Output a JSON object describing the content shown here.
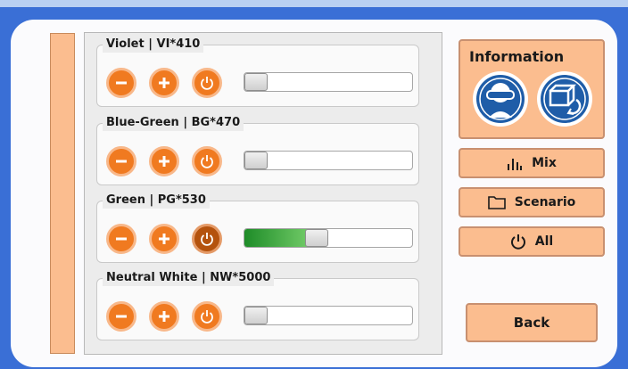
{
  "channels": [
    {
      "title": "Violet | VI*410",
      "level": 0.0,
      "power_on": false
    },
    {
      "title": "Blue-Green | BG*470",
      "level": 0.0,
      "power_on": false
    },
    {
      "title": "Green | PG*530",
      "level": 0.42,
      "power_on": true
    },
    {
      "title": "Neutral White | NW*5000",
      "level": 0.0,
      "power_on": false
    }
  ],
  "sidebar": {
    "info_title": "Information",
    "info_icons": [
      "goggles-safety-icon",
      "device-rotate-icon"
    ],
    "mix_label": "Mix",
    "scenario_label": "Scenario",
    "all_label": "All",
    "back_label": "Back"
  },
  "colors": {
    "background": "#3a6fd6",
    "accent_orange": "#f07a20",
    "accent_orange_active": "#b4520d",
    "button_fill": "#fbbd8f",
    "info_icon_blue": "#1f5da8",
    "slider_green": "#2e9a36"
  }
}
